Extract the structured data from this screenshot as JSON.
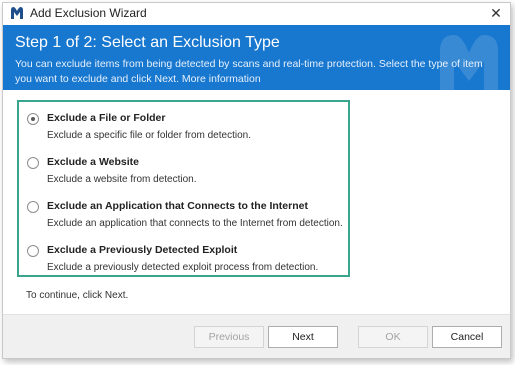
{
  "window": {
    "title": "Add Exclusion Wizard",
    "close_glyph": "✕"
  },
  "header": {
    "title": "Step 1 of 2: Select an Exclusion Type",
    "description": "You can exclude items from being detected by scans and real-time protection. Select the type of item you want to exclude and click Next. More information",
    "background_color": "#1877cf"
  },
  "options": [
    {
      "title": "Exclude a File or Folder",
      "description": "Exclude a specific file or folder from detection.",
      "selected": true
    },
    {
      "title": "Exclude a Website",
      "description": "Exclude a website from detection.",
      "selected": false
    },
    {
      "title": "Exclude an Application that Connects to the Internet",
      "description": "Exclude an application that connects to the Internet from detection.",
      "selected": false
    },
    {
      "title": "Exclude a Previously Detected Exploit",
      "description": "Exclude a previously detected exploit process from detection.",
      "selected": false
    }
  ],
  "continue_text": "To continue, click Next.",
  "buttons": {
    "previous": "Previous",
    "next": "Next",
    "ok": "OK",
    "cancel": "Cancel"
  },
  "colors": {
    "highlight_border": "#3aa58d",
    "header": "#1877cf",
    "footer": "#f0f0f0"
  },
  "icons": {
    "app": "malwarebytes-logo-icon",
    "close": "close-icon"
  }
}
